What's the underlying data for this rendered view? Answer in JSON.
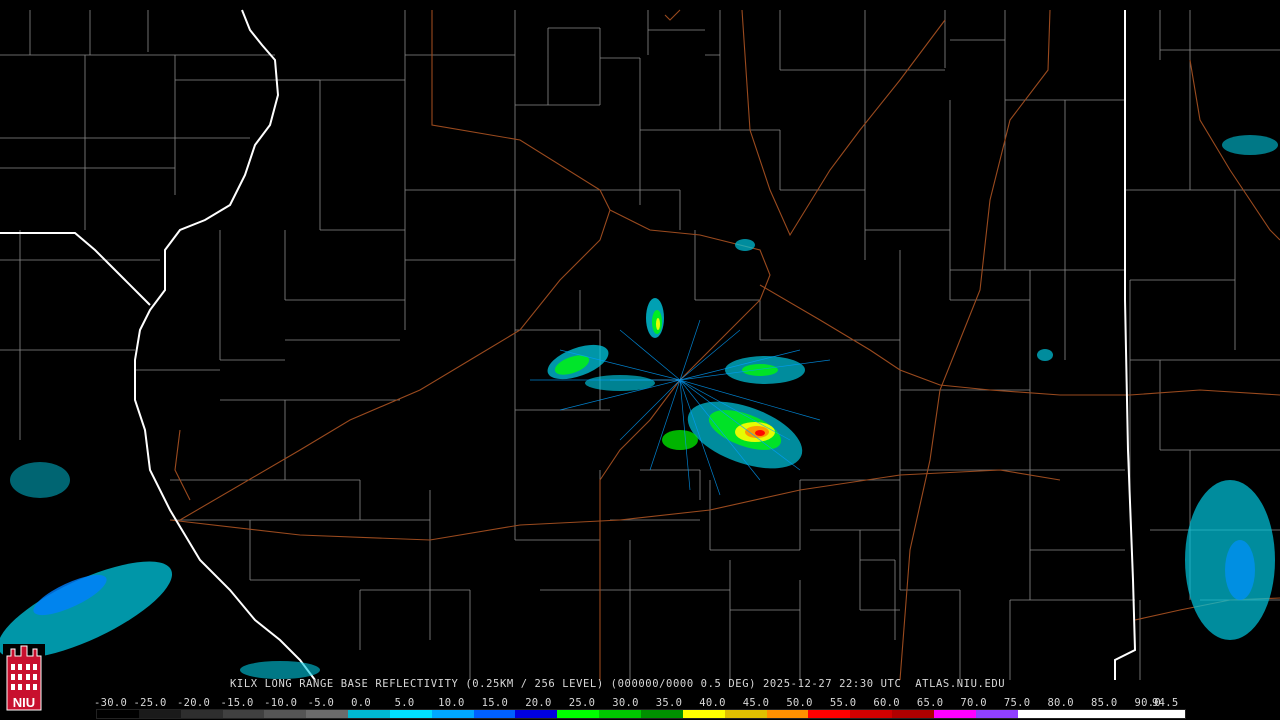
{
  "product_line": "KILX LONG RANGE BASE REFLECTIVITY (0.25KM / 256 LEVEL) (000000/0000 0.5 DEG) 2025-12-27 22:30 UTC  ATLAS.NIU.EDU",
  "logo_text": "NIU",
  "scale": {
    "labels": [
      "-30.0",
      "-25.0",
      "-20.0",
      "-15.0",
      "-10.0",
      "-5.0",
      "0.0",
      "5.0",
      "10.0",
      "15.0",
      "20.0",
      "25.0",
      "30.0",
      "35.0",
      "40.0",
      "45.0",
      "50.0",
      "55.0",
      "60.0",
      "65.0",
      "70.0",
      "75.0",
      "80.0",
      "85.0",
      "90.0",
      "94.5"
    ],
    "colors": [
      "#000000",
      "#1a1a1a",
      "#2e2e2e",
      "#404040",
      "#555555",
      "#6b6b6b",
      "#00b8d0",
      "#00e0ff",
      "#00a8ff",
      "#0060ff",
      "#0000e0",
      "#00ff00",
      "#00c800",
      "#009000",
      "#ffff00",
      "#e0c000",
      "#ff9000",
      "#ff0000",
      "#d00000",
      "#b00000",
      "#ff00ff",
      "#9040ff",
      "#ffffff",
      "#ffffff",
      "#ffffff",
      "#ffffff"
    ]
  },
  "colors": {
    "county_lines": "#8a8a8a",
    "state_lines": "#ffffff",
    "highways": "#9a4a1e"
  }
}
